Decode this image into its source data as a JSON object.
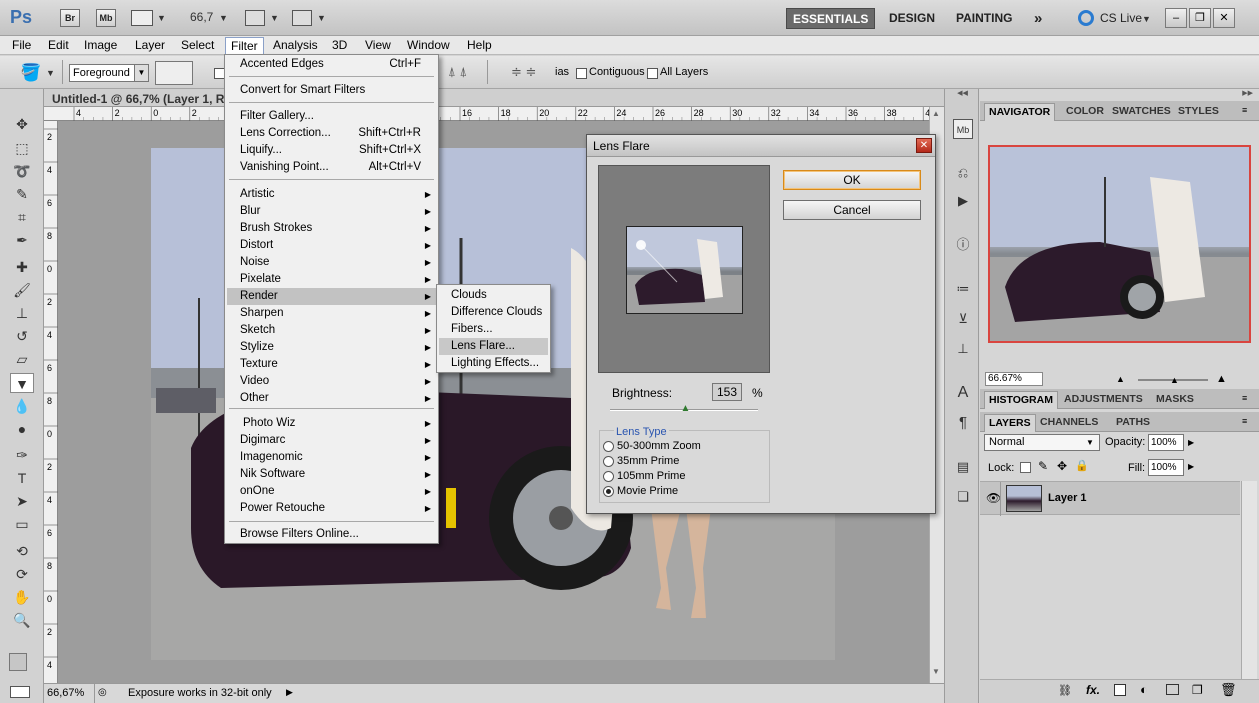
{
  "appbar": {
    "logo": "Ps",
    "br_label": "Br",
    "mb_label": "Mb",
    "zoom": "66,7",
    "workspaces": [
      "ESSENTIALS",
      "DESIGN",
      "PAINTING"
    ],
    "more": "»",
    "cslive": "CS Live"
  },
  "menubar": [
    "File",
    "Edit",
    "Image",
    "Layer",
    "Select",
    "Filter",
    "Analysis",
    "3D",
    "View",
    "Window",
    "Help"
  ],
  "options": {
    "fill_source": "Foreground",
    "contiguous_label": "Contiguous",
    "all_layers_label": "All Layers",
    "as_fragment": "ias"
  },
  "document": {
    "tab_title": "Untitled-1 @ 66,7% (Layer 1, R",
    "ruler_labels": [
      "4",
      "2",
      "0",
      "2",
      "4",
      "6",
      "8",
      "10",
      "12",
      "14",
      "16",
      "18",
      "20",
      "22",
      "24",
      "26",
      "28",
      "30",
      "32",
      "34",
      "36",
      "38",
      "40",
      "42"
    ],
    "vruler_labels": [
      "2",
      "4",
      "6",
      "8",
      "0",
      "2",
      "4",
      "6",
      "8",
      "0",
      "2",
      "4",
      "6",
      "8",
      "0",
      "2",
      "4"
    ]
  },
  "status": {
    "zoom": "66,67%",
    "message": "Exposure works in 32-bit only"
  },
  "filter_menu": {
    "top_items": [
      {
        "label": "Accented Edges",
        "shortcut": "Ctrl+F"
      },
      {
        "label": "Convert for Smart Filters",
        "shortcut": ""
      }
    ],
    "group2": [
      {
        "label": "Filter Gallery...",
        "shortcut": ""
      },
      {
        "label": "Lens Correction...",
        "shortcut": "Shift+Ctrl+R"
      },
      {
        "label": "Liquify...",
        "shortcut": "Shift+Ctrl+X"
      },
      {
        "label": "Vanishing Point...",
        "shortcut": "Alt+Ctrl+V"
      }
    ],
    "submenus": [
      "Artistic",
      "Blur",
      "Brush Strokes",
      "Distort",
      "Noise",
      "Pixelate",
      "Render",
      "Sharpen",
      "Sketch",
      "Stylize",
      "Texture",
      "Video",
      "Other"
    ],
    "plugins": [
      "Photo Wiz",
      "Digimarc",
      "Imagenomic",
      "Nik Software",
      "onOne",
      "Power Retouche"
    ],
    "browse": "Browse Filters Online...",
    "highlighted": "Render"
  },
  "render_submenu": {
    "items": [
      "Clouds",
      "Difference Clouds",
      "Fibers...",
      "Lens Flare...",
      "Lighting Effects..."
    ],
    "highlighted": "Lens Flare..."
  },
  "dialog": {
    "title": "Lens Flare",
    "ok": "OK",
    "cancel": "Cancel",
    "brightness_label": "Brightness:",
    "brightness_value": "153",
    "percent": "%",
    "brightness_level": 0.51,
    "lens_type_label": "Lens Type",
    "lens_types": [
      "50-300mm Zoom",
      "35mm Prime",
      "105mm Prime",
      "Movie Prime"
    ],
    "selected_lens": "Movie Prime"
  },
  "panels": {
    "top_tabs": [
      "NAVIGATOR",
      "COLOR",
      "SWATCHES",
      "STYLES"
    ],
    "nav_zoom": "66.67%",
    "mid_tabs": [
      "HISTOGRAM",
      "ADJUSTMENTS",
      "MASKS"
    ],
    "layer_tabs": [
      "LAYERS",
      "CHANNELS",
      "PATHS"
    ],
    "blend_mode": "Normal",
    "opacity_label": "Opacity:",
    "opacity": "100%",
    "lock_label": "Lock:",
    "fill_label": "Fill:",
    "fill": "100%",
    "layer_name": "Layer 1",
    "fx_label": "fx."
  },
  "colors": {
    "nav_border": "#d9453f",
    "menu_highlight": "#c2c2c2",
    "default_button": "#d88a1a"
  }
}
